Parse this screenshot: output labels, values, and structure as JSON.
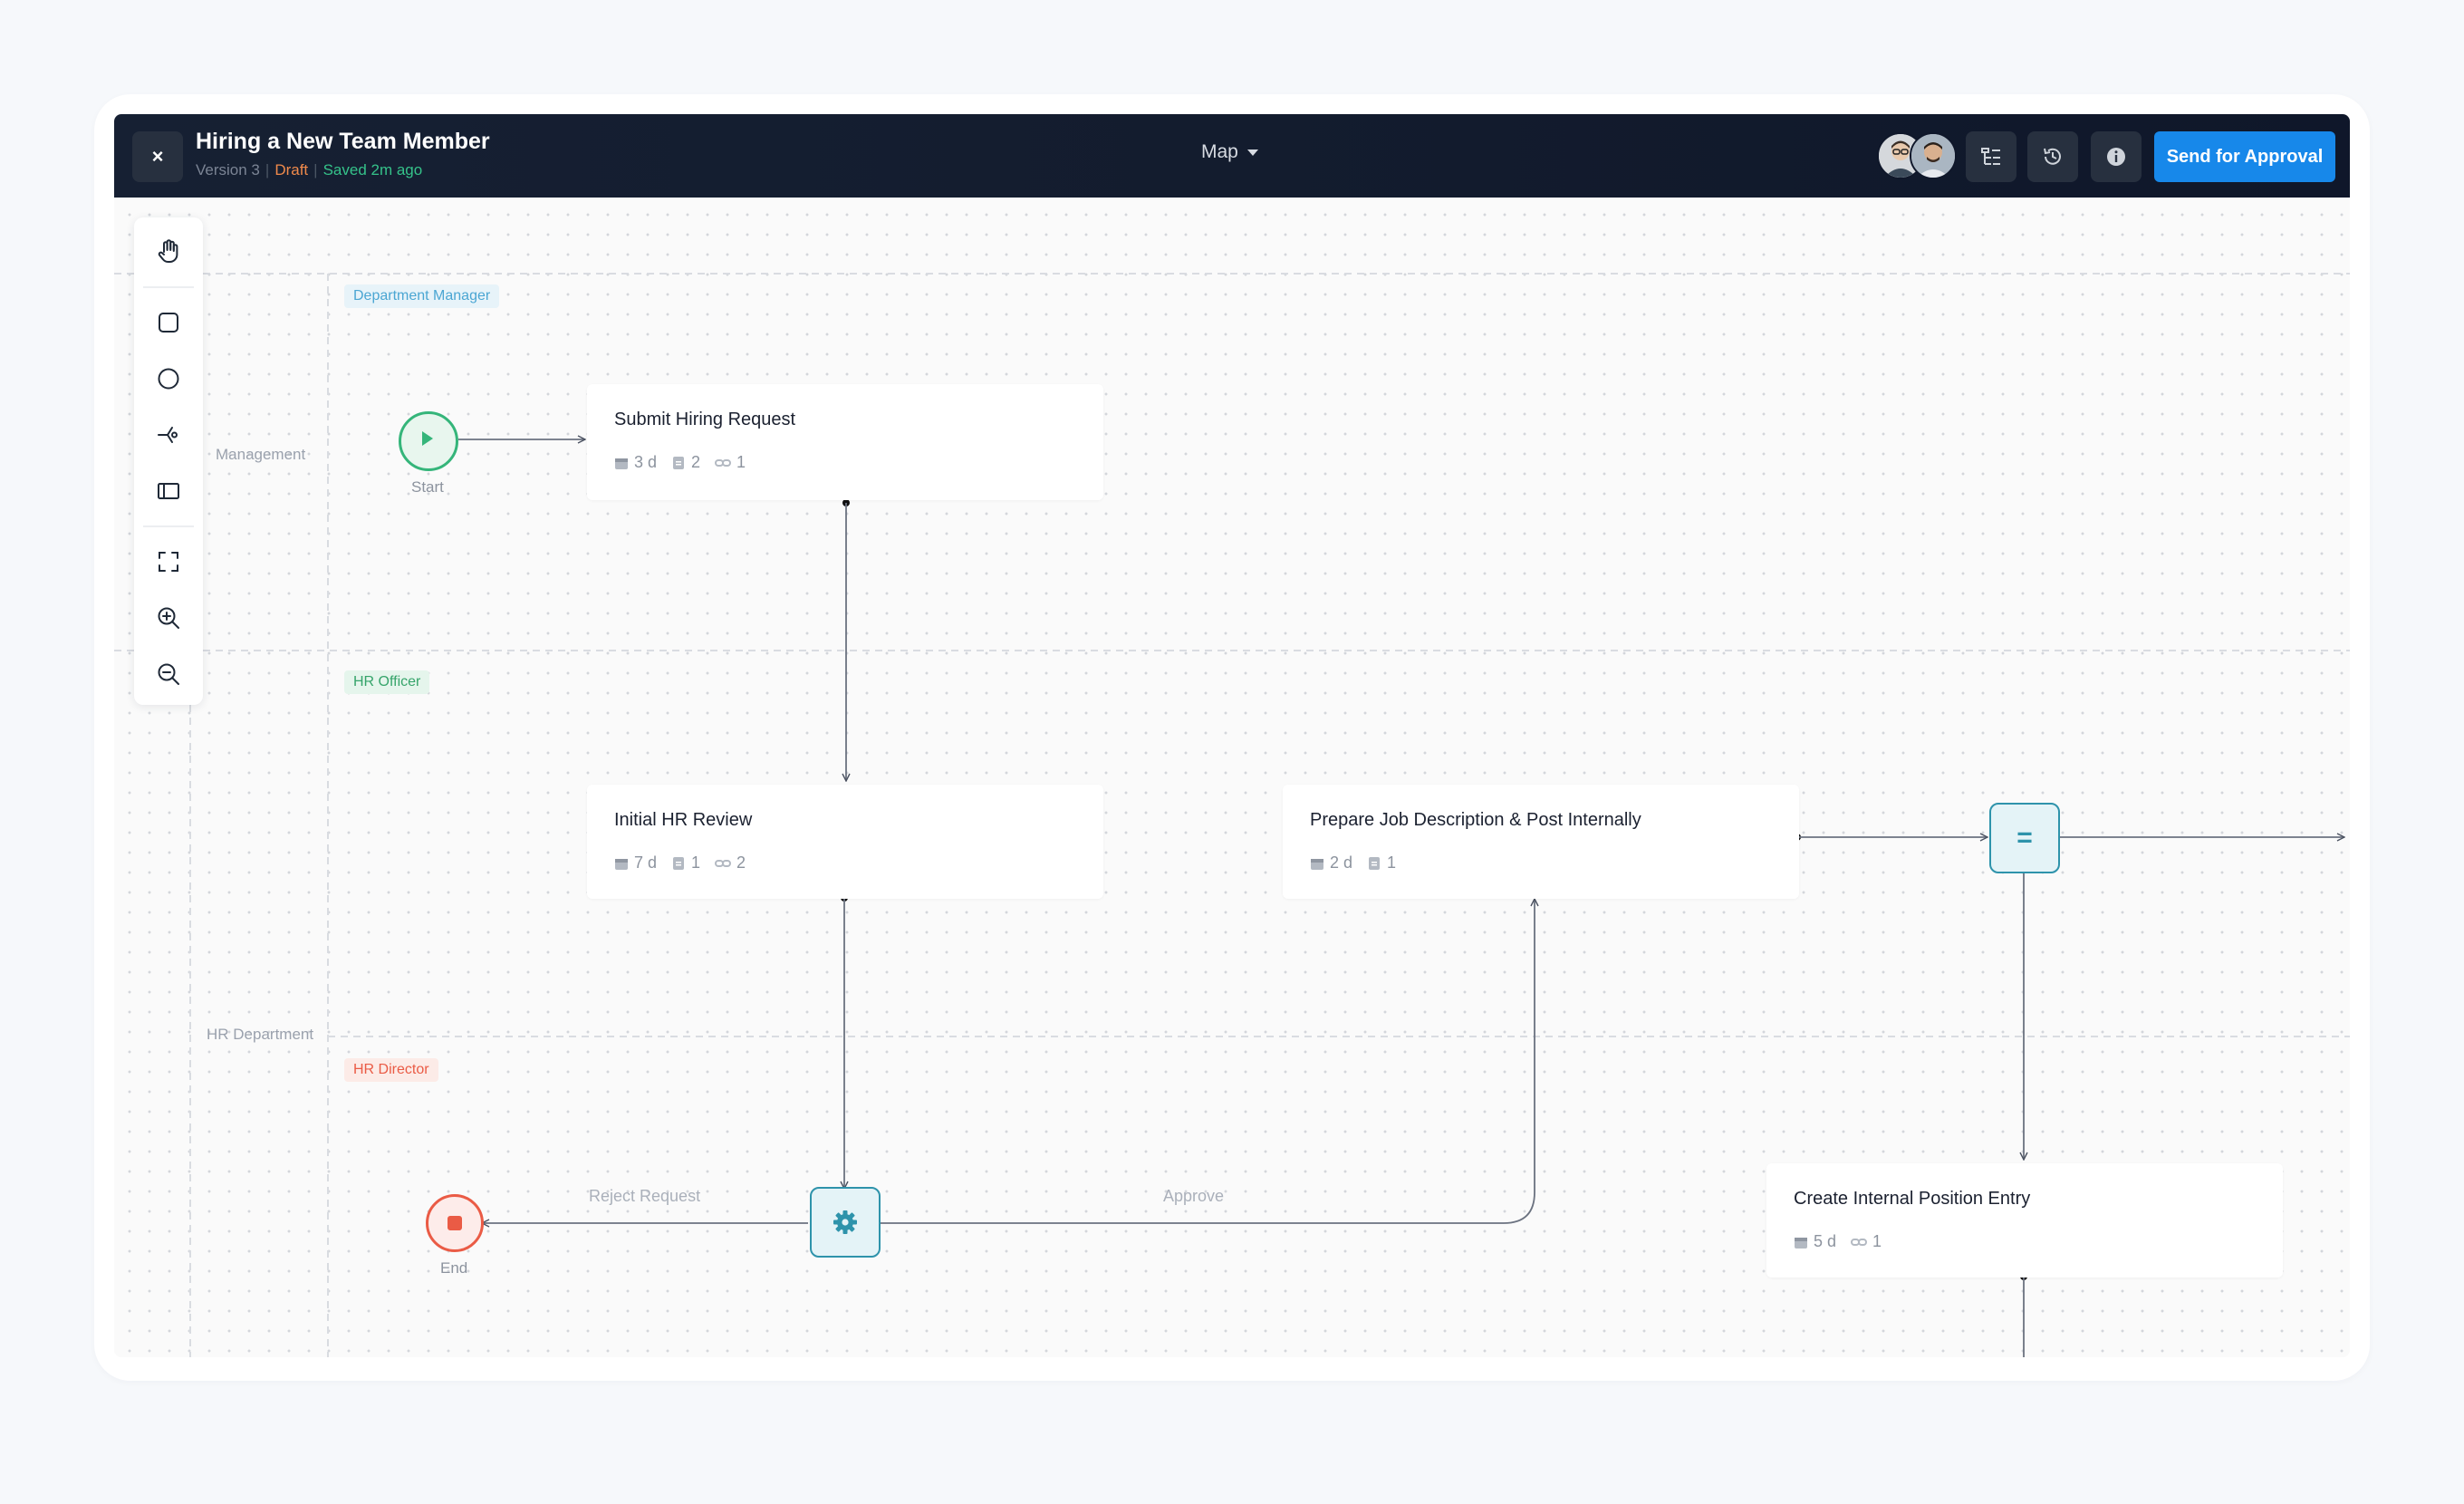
{
  "header": {
    "title": "Hiring a New Team Member",
    "version": "Version 3",
    "status": "Draft",
    "saved": "Saved 2m ago",
    "view": "Map",
    "close_label": "×",
    "approve_label": "Send for Approval"
  },
  "lanes": {
    "management": "Management",
    "hr_department": "HR Department"
  },
  "roles": {
    "department_manager": "Department Manager",
    "hr_officer": "HR Officer",
    "hr_director": "HR Director"
  },
  "nodes": {
    "start": "Start",
    "end": "End",
    "submit": {
      "title": "Submit Hiring Request",
      "duration": "3 d",
      "docs": "2",
      "links": "1"
    },
    "review": {
      "title": "Initial HR Review",
      "duration": "7 d",
      "docs": "1",
      "links": "2"
    },
    "prepare": {
      "title": "Prepare Job Description & Post Internally",
      "duration": "2 d",
      "docs": "1"
    },
    "create": {
      "title": "Create Internal Position Entry",
      "duration": "5 d",
      "links": "1"
    },
    "gateway_symbol": "="
  },
  "edges": {
    "reject": "Reject Request",
    "approve": "Approve"
  },
  "colors": {
    "accent": "#1788ea",
    "start": "#35b57a",
    "end": "#ea5b45",
    "gateway": "#2e93ab"
  }
}
